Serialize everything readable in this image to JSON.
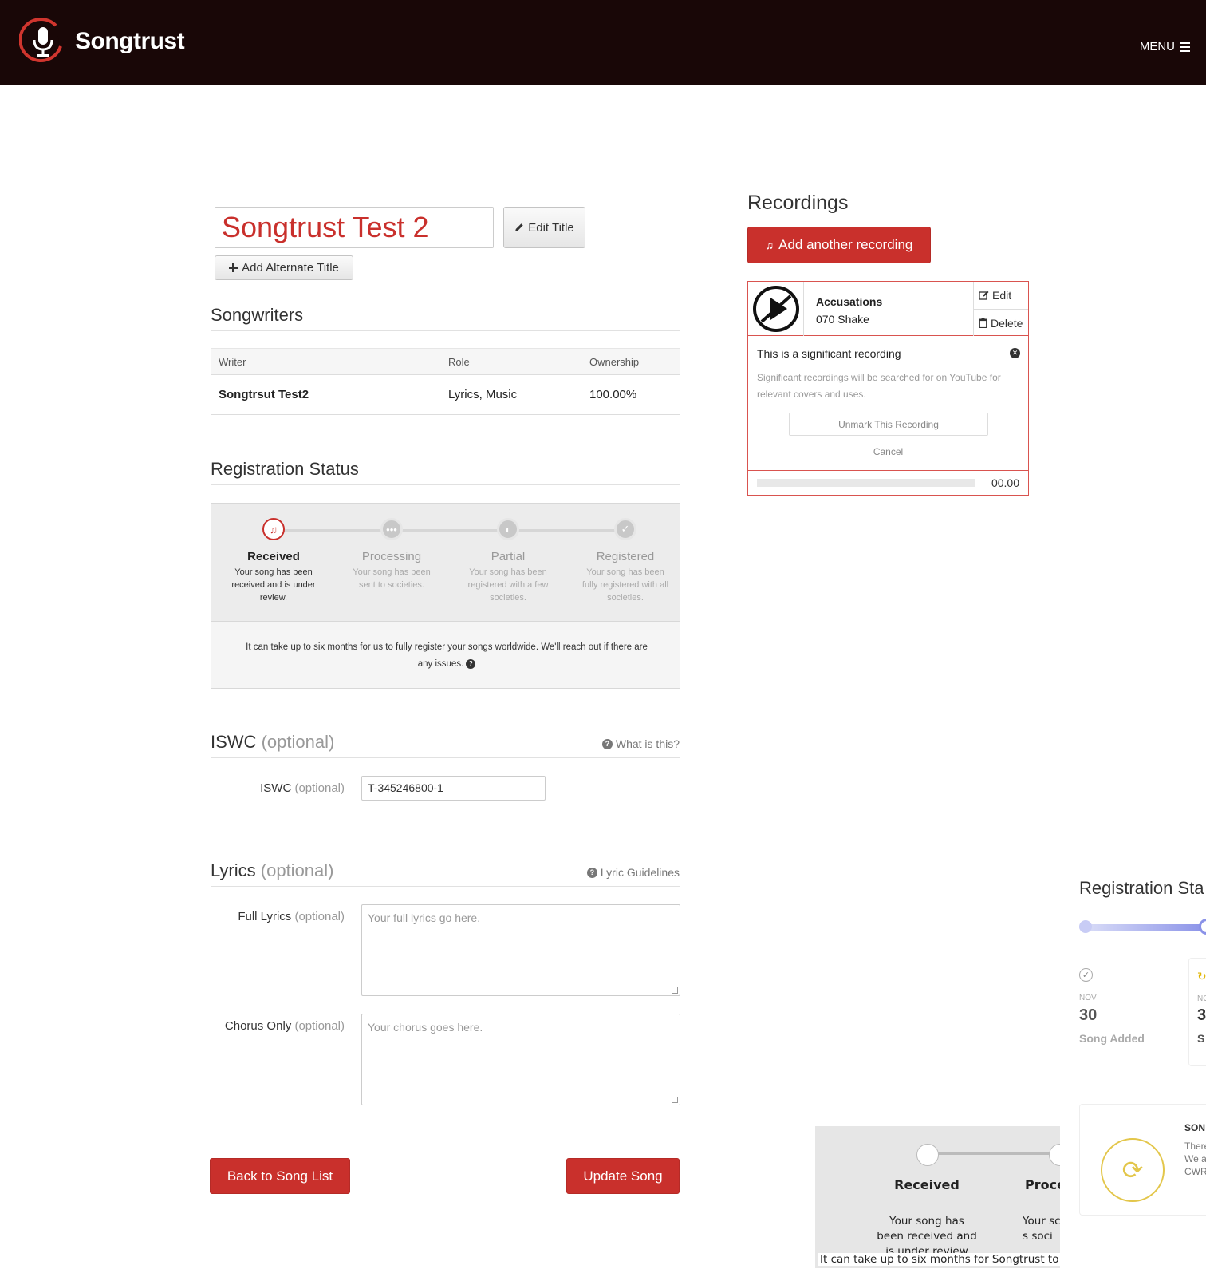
{
  "header": {
    "brand": "Songtrust",
    "menu_label": "MENU"
  },
  "song": {
    "title": "Songtrust Test 2",
    "edit_title_label": "Edit Title",
    "add_alternate_title_label": "Add Alternate Title"
  },
  "songwriters": {
    "heading": "Songwriters",
    "columns": [
      "Writer",
      "Role",
      "Ownership"
    ],
    "rows": [
      {
        "writer": "Songtrsut Test2",
        "role": "Lyrics, Music",
        "ownership": "100.00%"
      }
    ]
  },
  "registration": {
    "heading": "Registration Status",
    "steps": [
      {
        "title": "Received",
        "desc": "Your song has been received and is under review."
      },
      {
        "title": "Processing",
        "desc": "Your song has been sent to societies."
      },
      {
        "title": "Partial",
        "desc": "Your song has been registered with a few societies."
      },
      {
        "title": "Registered",
        "desc": "Your song has been fully registered with all societies."
      }
    ],
    "note": "It can take up to six months for us to fully register your songs worldwide. We'll reach out if there are any issues."
  },
  "iswc": {
    "heading": "ISWC",
    "optional": "(optional)",
    "help_label": "What is this?",
    "field_label": "ISWC",
    "value": "T-345246800-1"
  },
  "lyrics": {
    "heading": "Lyrics",
    "optional": "(optional)",
    "help_label": "Lyric Guidelines",
    "full_label": "Full Lyrics",
    "full_placeholder": "Your full lyrics go here.",
    "chorus_label": "Chorus Only",
    "chorus_placeholder": "Your chorus goes here."
  },
  "actions": {
    "back_label": "Back to Song List",
    "update_label": "Update Song"
  },
  "recordings": {
    "heading": "Recordings",
    "add_label": "Add another recording",
    "items": [
      {
        "title": "Accusations",
        "artist": "070 Shake",
        "edit_label": "Edit",
        "delete_label": "Delete",
        "significant_title": "This is a significant recording",
        "significant_desc": "Significant recordings will be searched for on YouTube for relevant covers and uses.",
        "unmark_label": "Unmark This Recording",
        "cancel_label": "Cancel",
        "time": "00.00"
      }
    ]
  },
  "overlay_timeline": {
    "heading": "Registration Sta",
    "event_month": "NOV",
    "event_day": "30",
    "event_label": "Song Added",
    "event2_month": "NO",
    "event2_day": "3",
    "event2_label": "S"
  },
  "overlay_song_card": {
    "heading": "SON",
    "text": "There make We a detai CWR"
  },
  "overlay_status": {
    "step1_title": "Received",
    "step1_desc": "Your song has been received and is under review",
    "step2_title": "Proce",
    "step2_desc": "Your sc been s soci",
    "note": "It can take up to six months for Songtrust to fu"
  }
}
